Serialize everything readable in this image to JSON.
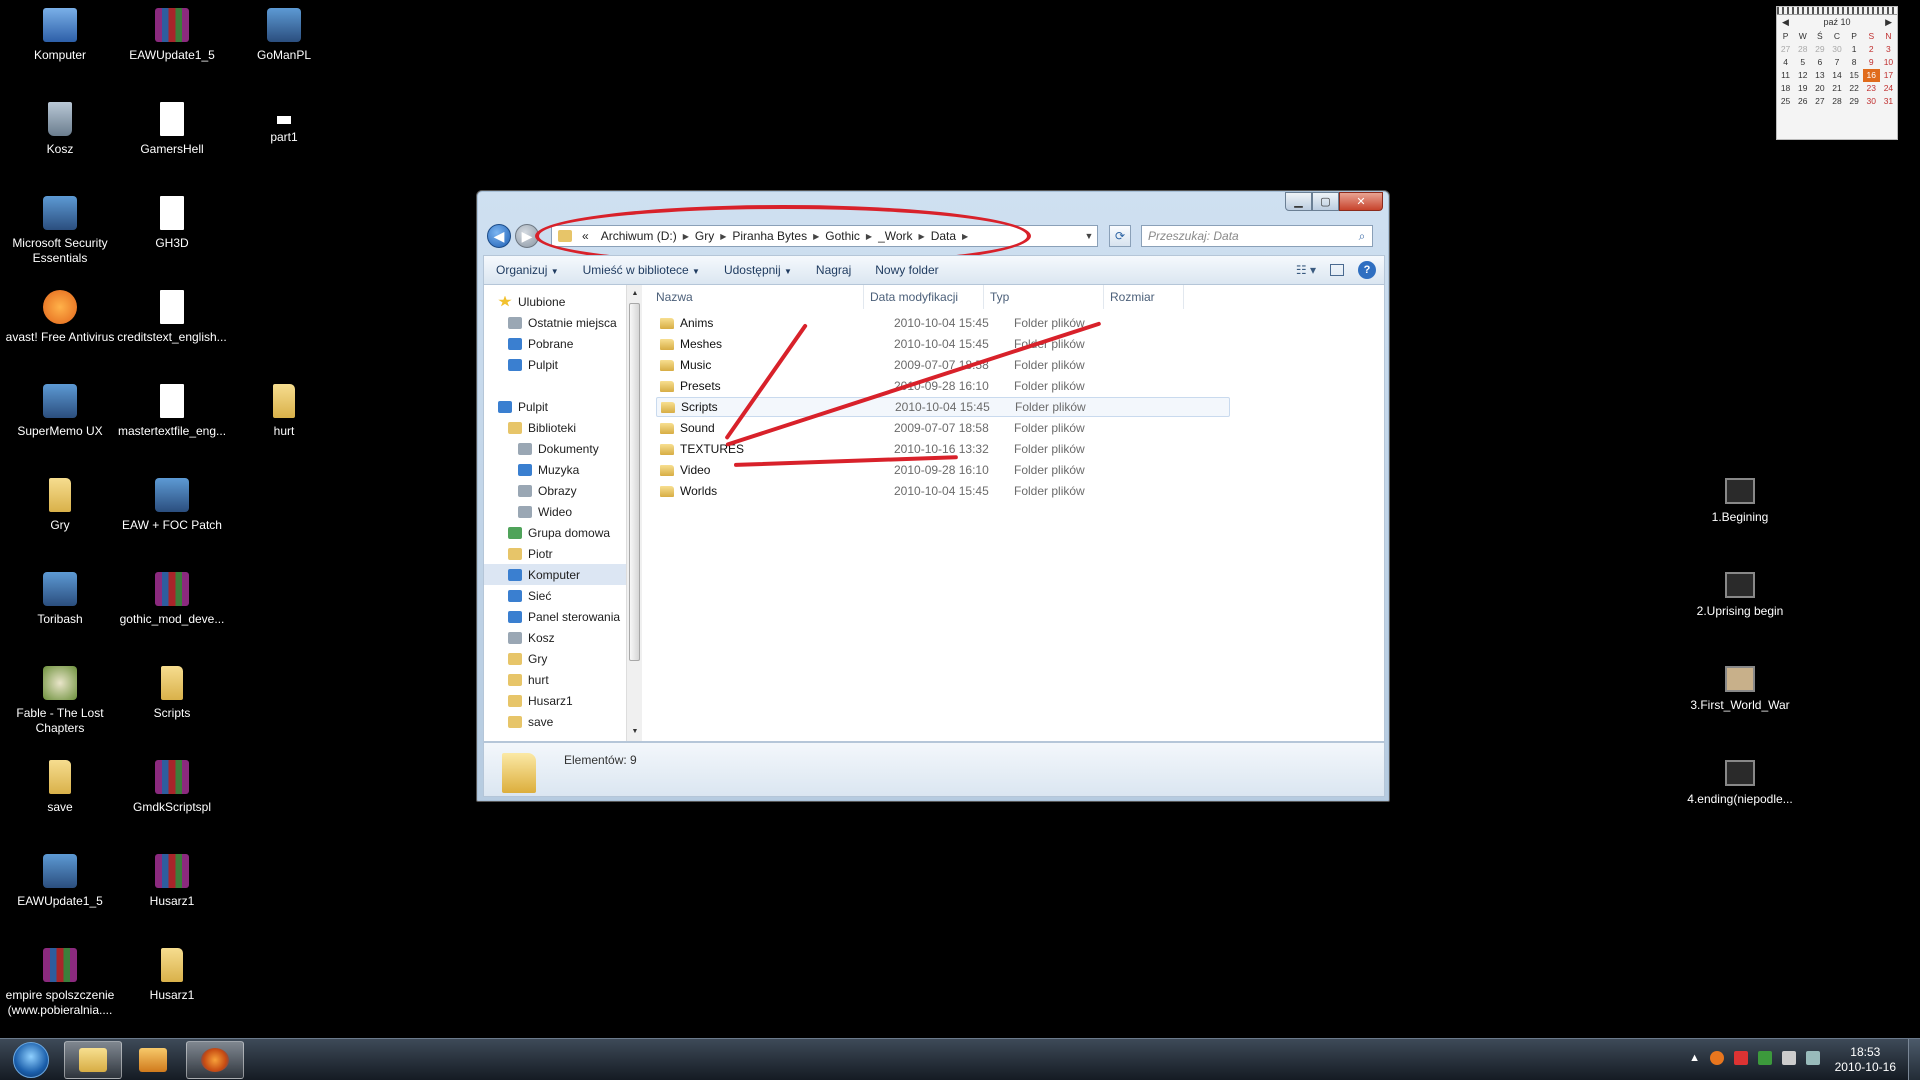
{
  "desktop": {
    "icons_left": [
      {
        "label": "Komputer",
        "icon": "computer-icon"
      },
      {
        "label": "EAWUpdate1_5",
        "icon": "winrar-icon"
      },
      {
        "label": "GoManPL",
        "icon": "installer-icon"
      },
      {
        "label": "Kosz",
        "icon": "recycle-bin-icon"
      },
      {
        "label": "GamersHell",
        "icon": "document-icon"
      },
      {
        "label": "part1",
        "icon": "file-icon"
      },
      {
        "label": "Microsoft Security Essentials",
        "icon": "security-icon"
      },
      {
        "label": "GH3D",
        "icon": "document-icon"
      },
      {
        "label": "avast! Free Antivirus",
        "icon": "avast-icon"
      },
      {
        "label": "creditstext_english...",
        "icon": "document-icon"
      },
      {
        "label": "SuperMemo UX",
        "icon": "supermemo-icon"
      },
      {
        "label": "mastertextfile_eng...",
        "icon": "document-icon"
      },
      {
        "label": "hurt",
        "icon": "folder-icon"
      },
      {
        "label": "Gry",
        "icon": "folder-icon"
      },
      {
        "label": "EAW + FOC Patch",
        "icon": "patch-icon"
      },
      {
        "label": "Toribash",
        "icon": "toribash-icon"
      },
      {
        "label": "gothic_mod_deve...",
        "icon": "winrar-icon"
      },
      {
        "label": "Fable - The Lost Chapters",
        "icon": "fable-icon"
      },
      {
        "label": "Scripts",
        "icon": "folder-icon"
      },
      {
        "label": "save",
        "icon": "folder-icon"
      },
      {
        "label": "GmdkScriptspl",
        "icon": "winrar-icon"
      },
      {
        "label": "EAWUpdate1_5",
        "icon": "installer-icon"
      },
      {
        "label": "Husarz1",
        "icon": "winrar-icon"
      },
      {
        "label": "empire spolszczenie (www.pobieralnia....",
        "icon": "winrar-icon"
      },
      {
        "label": "Husarz1",
        "icon": "folder-icon"
      }
    ],
    "icons_right": [
      {
        "label": "1.Begining",
        "icon": "video-icon"
      },
      {
        "label": "2.Uprising begin",
        "icon": "video-icon"
      },
      {
        "label": "3.First_World_War",
        "icon": "video-icon"
      },
      {
        "label": "4.ending(niepodle...",
        "icon": "video-icon"
      }
    ]
  },
  "calendar": {
    "month": "paź 10",
    "weekdays": [
      "P",
      "W",
      "Ś",
      "C",
      "P",
      "S",
      "N"
    ],
    "weeks": [
      [
        "27",
        "28",
        "29",
        "30",
        "1",
        "2",
        "3"
      ],
      [
        "4",
        "5",
        "6",
        "7",
        "8",
        "9",
        "10"
      ],
      [
        "11",
        "12",
        "13",
        "14",
        "15",
        "16",
        "17"
      ],
      [
        "18",
        "19",
        "20",
        "21",
        "22",
        "23",
        "24"
      ],
      [
        "25",
        "26",
        "27",
        "28",
        "29",
        "30",
        "31"
      ]
    ],
    "today": "16"
  },
  "explorer": {
    "breadcrumb": [
      "Archiwum (D:)",
      "Gry",
      "Piranha Bytes",
      "Gothic",
      "_Work",
      "Data"
    ],
    "breadcrumb_prefix": "«",
    "search_placeholder": "Przeszukaj: Data",
    "toolbar": {
      "organize": "Organizuj",
      "library": "Umieść w bibliotece",
      "share": "Udostępnij",
      "burn": "Nagraj",
      "new_folder": "Nowy folder"
    },
    "nav": [
      {
        "label": "Ulubione",
        "icon": "star",
        "indent": 0
      },
      {
        "label": "Ostatnie miejsca",
        "icon": "gray",
        "indent": 1
      },
      {
        "label": "Pobrane",
        "icon": "blue",
        "indent": 1
      },
      {
        "label": "Pulpit",
        "icon": "blue",
        "indent": 1
      },
      {
        "label": "",
        "icon": "",
        "indent": 0
      },
      {
        "label": "Pulpit",
        "icon": "blue",
        "indent": 0
      },
      {
        "label": "Biblioteki",
        "icon": "fold",
        "indent": 1
      },
      {
        "label": "Dokumenty",
        "icon": "gray",
        "indent": 2
      },
      {
        "label": "Muzyka",
        "icon": "blue",
        "indent": 2
      },
      {
        "label": "Obrazy",
        "icon": "gray",
        "indent": 2
      },
      {
        "label": "Wideo",
        "icon": "gray",
        "indent": 2
      },
      {
        "label": "Grupa domowa",
        "icon": "green",
        "indent": 1
      },
      {
        "label": "Piotr",
        "icon": "fold",
        "indent": 1
      },
      {
        "label": "Komputer",
        "icon": "blue",
        "indent": 1,
        "selected": true
      },
      {
        "label": "Sieć",
        "icon": "blue",
        "indent": 1
      },
      {
        "label": "Panel sterowania",
        "icon": "blue",
        "indent": 1
      },
      {
        "label": "Kosz",
        "icon": "gray",
        "indent": 1
      },
      {
        "label": "Gry",
        "icon": "fold",
        "indent": 1
      },
      {
        "label": "hurt",
        "icon": "fold",
        "indent": 1
      },
      {
        "label": "Husarz1",
        "icon": "fold",
        "indent": 1
      },
      {
        "label": "save",
        "icon": "fold",
        "indent": 1
      }
    ],
    "columns": [
      "Nazwa",
      "Data modyfikacji",
      "Typ",
      "Rozmiar"
    ],
    "files": [
      {
        "name": "Anims",
        "date": "2010-10-04 15:45",
        "type": "Folder plików"
      },
      {
        "name": "Meshes",
        "date": "2010-10-04 15:45",
        "type": "Folder plików"
      },
      {
        "name": "Music",
        "date": "2009-07-07 18:58",
        "type": "Folder plików"
      },
      {
        "name": "Presets",
        "date": "2010-09-28 16:10",
        "type": "Folder plików"
      },
      {
        "name": "Scripts",
        "date": "2010-10-04 15:45",
        "type": "Folder plików",
        "selected": true
      },
      {
        "name": "Sound",
        "date": "2009-07-07 18:58",
        "type": "Folder plików"
      },
      {
        "name": "TEXTURES",
        "date": "2010-10-16 13:32",
        "type": "Folder plików"
      },
      {
        "name": "Video",
        "date": "2010-09-28 16:10",
        "type": "Folder plików"
      },
      {
        "name": "Worlds",
        "date": "2010-10-04 15:45",
        "type": "Folder plików"
      }
    ],
    "status": "Elementów: 9"
  },
  "taskbar": {
    "clock_time": "18:53",
    "clock_date": "2010-10-16"
  },
  "colors": {
    "annotation_red": "#d8212a",
    "window_frame": "#b6cbe0",
    "today_highlight": "#e06b1c"
  }
}
